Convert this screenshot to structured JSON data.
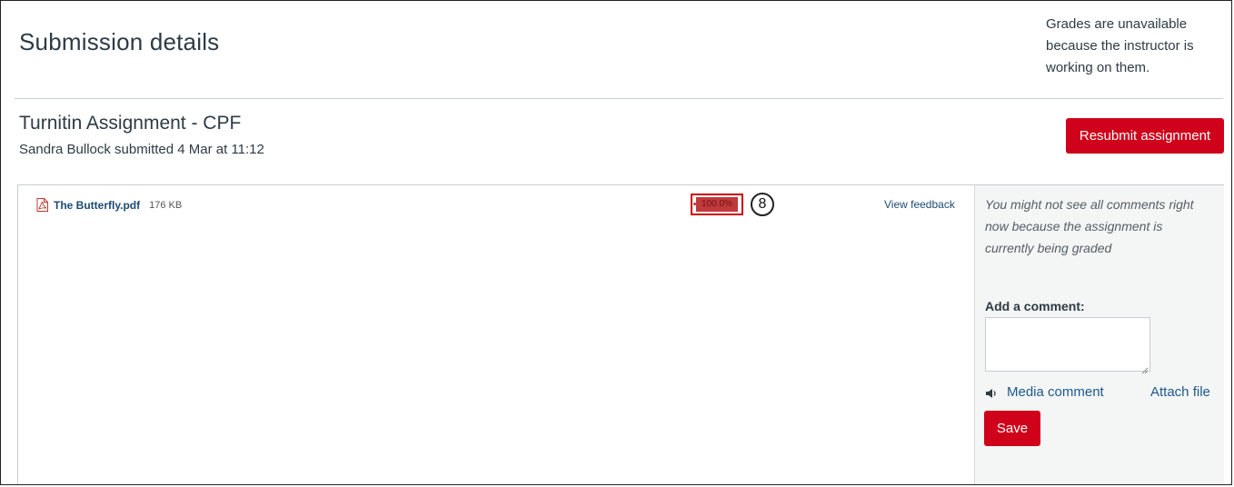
{
  "page": {
    "title": "Submission details",
    "grades_note": "Grades are unavailable because the instructor is working on them."
  },
  "assignment": {
    "title": "Turnitin Assignment - CPF",
    "submitted_by": "Sandra Bullock submitted 4 Mar at 11:12",
    "resubmit_label": "Resubmit assignment"
  },
  "submission": {
    "file_icon": "pdf-file-icon",
    "file_name": "The Butterfly.pdf",
    "file_size": "176 KB",
    "similarity_score": "100.0%",
    "callout_number": "8",
    "view_feedback_label": "View feedback"
  },
  "comments": {
    "note": "You might not see all comments right now because the assignment is currently being graded",
    "add_comment_label": "Add a comment:",
    "comment_value": "",
    "media_icon": "speaker-icon",
    "media_comment_label": "Media comment",
    "attach_file_label": "Attach file",
    "save_label": "Save"
  },
  "colors": {
    "accent_red": "#d0021b",
    "link_blue": "#1c4a73",
    "text": "#2d3b45",
    "sidebar_bg": "#f4f5f5",
    "highlight_box": "#cc0000"
  }
}
